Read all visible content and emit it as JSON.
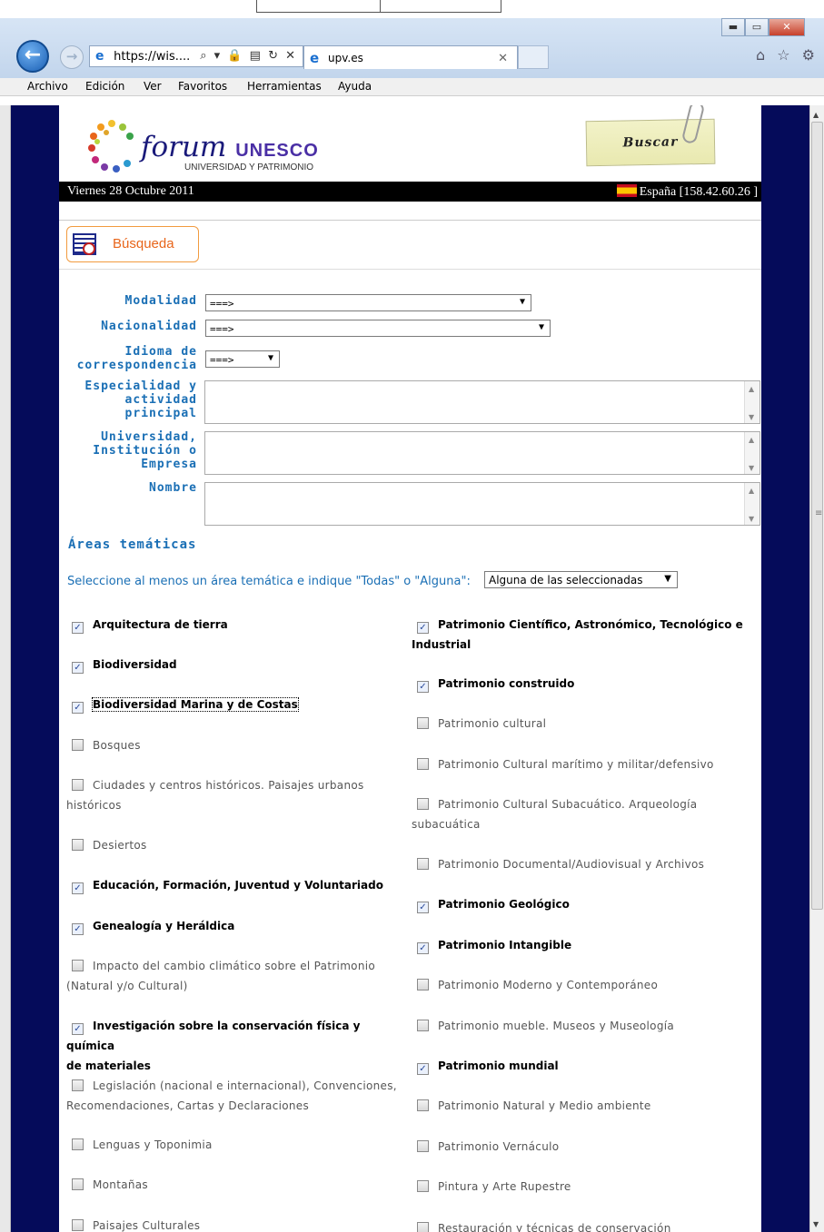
{
  "browser": {
    "address_url": "https://wis....",
    "address_tools": "⌕ ▾ 🔒 ▤ ↻ ✕",
    "tab_title": "upv.es",
    "window_buttons": {
      "minimize": "▬",
      "maximize": "▭",
      "close": "✕"
    },
    "right_icons": "⌂ ☆ ⚙"
  },
  "menu": [
    "Archivo",
    "Edición",
    "Ver",
    "Favoritos",
    "Herramientas",
    "Ayuda"
  ],
  "header": {
    "brand_italic": "forum",
    "brand_bold": "UNESCO",
    "brand_sub": "UNIVERSIDAD Y PATRIMONIO",
    "note_button": "Buscar",
    "date": "Viernes 28 Octubre 2011",
    "location": "España [158.42.60.26 ]"
  },
  "search_tab": {
    "label": "Búsqueda"
  },
  "form": {
    "modalidad": {
      "label": "Modalidad",
      "value": "===>"
    },
    "nacionalidad": {
      "label": "Nacionalidad",
      "value": "===>"
    },
    "idioma": {
      "label_line1": "Idioma de",
      "label_line2": "correspondencia",
      "value": "===>"
    },
    "especialidad": {
      "label_line1": "Especialidad y",
      "label_line2": "actividad",
      "label_line3": "principal",
      "value": ""
    },
    "universidad": {
      "label_line1": "Universidad,",
      "label_line2": "Institución o",
      "label_line3": "Empresa",
      "value": ""
    },
    "nombre": {
      "label": "Nombre",
      "value": ""
    }
  },
  "areas": {
    "title": "Áreas temáticas",
    "instruction": "Seleccione al menos un área temática e indique \"Todas\" o \"Alguna\":",
    "mode": "Alguna de las seleccionadas",
    "left": [
      {
        "label": "Arquitectura de tierra",
        "checked": true
      },
      {
        "label": "Biodiversidad",
        "checked": true
      },
      {
        "label": "Biodiversidad Marina y de Costas",
        "checked": true
      },
      {
        "label": "Bosques",
        "checked": false
      },
      {
        "label_line1": "Ciudades y centros históricos. Paisajes urbanos",
        "label_line2": "históricos",
        "checked": false
      },
      {
        "label": "Desiertos",
        "checked": false
      },
      {
        "label": "Educación, Formación, Juventud y Voluntariado",
        "checked": true
      },
      {
        "label": "Genealogía y Heráldica",
        "checked": true
      },
      {
        "label_line1": "Impacto del cambio climático sobre el Patrimonio",
        "label_line2": "(Natural y/o Cultural)",
        "checked": false
      },
      {
        "label_line1": "Investigación sobre la conservación física y química",
        "label_line2": "de materiales",
        "checked": true
      },
      {
        "label_line1": "Legislación (nacional e internacional), Convenciones,",
        "label_line2": "Recomendaciones, Cartas y Declaraciones",
        "checked": false
      },
      {
        "label": "Lenguas y Toponimia",
        "checked": false
      },
      {
        "label": "Montañas",
        "checked": false
      },
      {
        "label": "Paisajes Culturales",
        "checked": false
      }
    ],
    "right": [
      {
        "label_line1": "Patrimonio Científico, Astronómico, Tecnológico e",
        "label_line2": "Industrial",
        "checked": true
      },
      {
        "label": "Patrimonio construido",
        "checked": true
      },
      {
        "label": "Patrimonio cultural",
        "checked": false
      },
      {
        "label": "Patrimonio Cultural marítimo y militar/defensivo",
        "checked": false
      },
      {
        "label_line1": "Patrimonio Cultural Subacuático. Arqueología",
        "label_line2": "subacuática",
        "checked": false
      },
      {
        "label": "Patrimonio Documental/Audiovisual y Archivos",
        "checked": false
      },
      {
        "label": "Patrimonio Geológico",
        "checked": true
      },
      {
        "label": "Patrimonio Intangible",
        "checked": true
      },
      {
        "label": "Patrimonio Moderno y Contemporáneo",
        "checked": false
      },
      {
        "label": "Patrimonio mueble. Museos y Museología",
        "checked": false
      },
      {
        "label": "Patrimonio mundial",
        "checked": true
      },
      {
        "label": "Patrimonio Natural y Medio ambiente",
        "checked": false
      },
      {
        "label": "Patrimonio Vernáculo",
        "checked": false
      },
      {
        "label": "Pintura y Arte Rupestre",
        "checked": false
      },
      {
        "label": "Restauración y técnicas de conservación",
        "checked": false
      }
    ]
  },
  "check_mark": "✓",
  "colors": {
    "navy": "#050b5a",
    "label_blue": "#1a6fb5",
    "accent_orange": "#f29b3f"
  }
}
